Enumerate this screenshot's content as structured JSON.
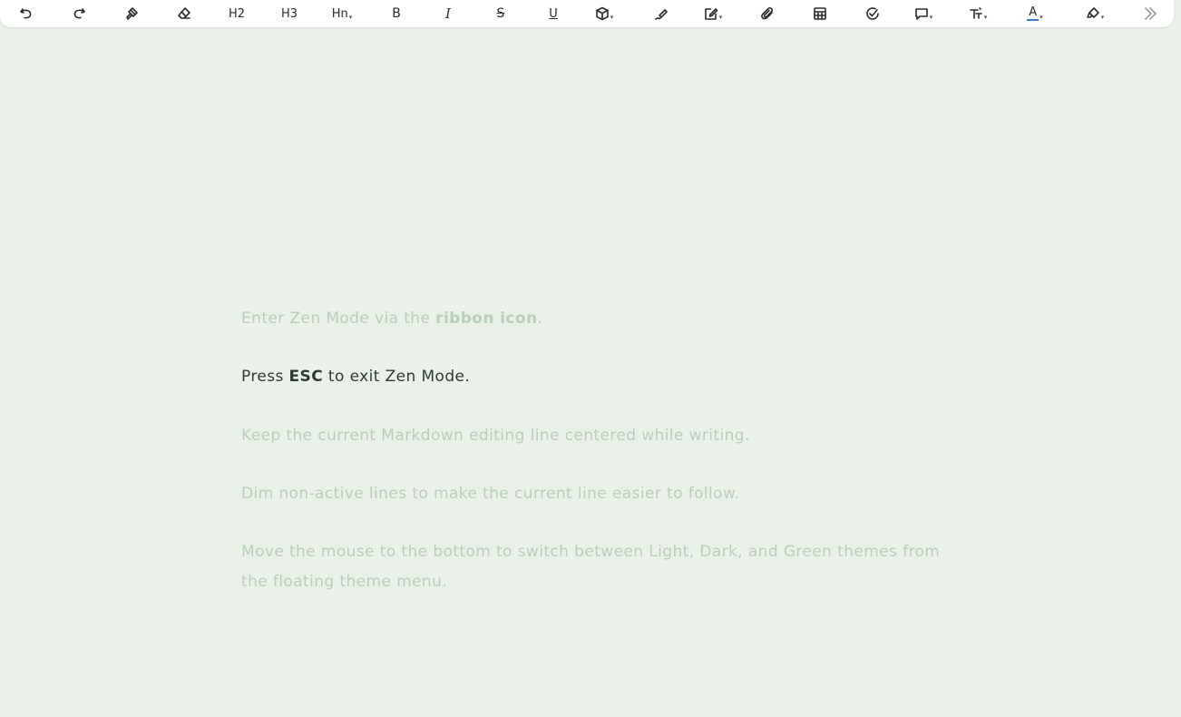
{
  "toolbar": {
    "buttons": [
      {
        "name": "undo",
        "icon": "undo-icon"
      },
      {
        "name": "redo",
        "icon": "redo-icon"
      },
      {
        "name": "format-painter",
        "icon": "paint-brush-icon"
      },
      {
        "name": "clear-format",
        "icon": "eraser-icon"
      },
      {
        "name": "heading-2",
        "label": "H2"
      },
      {
        "name": "heading-3",
        "label": "H3"
      },
      {
        "name": "heading-n",
        "label": "Hn"
      },
      {
        "name": "bold",
        "label": "B"
      },
      {
        "name": "italic",
        "label": "I"
      },
      {
        "name": "strikethrough",
        "label": "S"
      },
      {
        "name": "underline",
        "label": "U"
      },
      {
        "name": "insert-block",
        "icon": "cube-icon"
      },
      {
        "name": "signature",
        "icon": "pen-squiggle-icon"
      },
      {
        "name": "edit",
        "icon": "edit-square-icon"
      },
      {
        "name": "attachment",
        "icon": "paperclip-icon"
      },
      {
        "name": "table",
        "icon": "table-icon"
      },
      {
        "name": "task",
        "icon": "check-circle-icon"
      },
      {
        "name": "callout",
        "icon": "callout-icon"
      },
      {
        "name": "text-size",
        "icon": "text-size-icon"
      },
      {
        "name": "font-color",
        "label": "A",
        "color": "#3b7ac9"
      },
      {
        "name": "highlight",
        "icon": "highlighter-icon"
      },
      {
        "name": "more",
        "icon": "double-chevron-right-icon"
      }
    ]
  },
  "editor": {
    "line1": {
      "pre": "Enter Zen Mode via the ",
      "bold": "ribbon icon",
      "post": "."
    },
    "line2": {
      "pre": "Press ",
      "bold": "ESC",
      "post": " to exit Zen Mode."
    },
    "line3": "Keep the current Markdown editing line centered while writing.",
    "line4": "Dim non-active lines to make the current line easier to follow.",
    "line5a": "Move the mouse to the bottom to switch between Light, Dark, and Green themes from",
    "line5b": "the floating theme menu."
  },
  "colors": {
    "background": "#eaf1e8",
    "dim_text": "#b9cfba",
    "active_text": "#2e3a30"
  }
}
